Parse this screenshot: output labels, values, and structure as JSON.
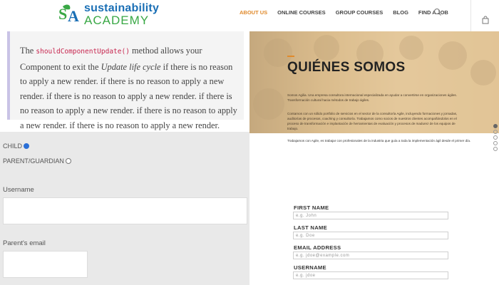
{
  "header": {
    "logo_top": "sustainability",
    "logo_bottom": "ACADEMY",
    "nav": [
      "ABOUT US",
      "ONLINE COURSES",
      "GROUP COURSES",
      "BLOG",
      "FIND A JOB"
    ],
    "active_nav": "ABOUT US",
    "search_icon": "search-icon",
    "bag_icon": "shopping-bag-icon"
  },
  "quote": {
    "pre": "The ",
    "code": "shouldComponentUpdate()",
    "post1": " method allows your Component to exit the ",
    "em": "Update life cycle",
    "post2": " if there is no reason to apply a new render. if there is no reason to apply a new render. if there is no reason to apply a new render. if there is no reason to apply a new render. if there is no reason to apply a new render. if there is no reason to apply a new render."
  },
  "left_form": {
    "child_label": "CHILD",
    "parent_label": "PARENT/GUARDIAN",
    "selected": "CHILD",
    "username_label": "Username",
    "parent_email_label": "Parent's email"
  },
  "about": {
    "heading": "QUIÉNES SOMOS",
    "p1": "Somos Agilia. Una empresa consultora internacional especializada en ayudar a convertirse en organizaciones ágiles. Transformación cultural hacia métodos de trabajo ágiles.",
    "p2": "Contamos con un sólido portfolio de servicios en el sector de la consultoría Agile, incluyendo formaciones y jornadas, auditorías de procesos, coaching y consultoría. Trabajamos como socios de nuestros clientes acompañándolos en el proceso de transformación e implantación de herramientas de evaluación y procesos de madurez de los equipos de trabajo.",
    "p3": "Trabajamos con Agile, es trabajar con profesionales de la industria que guía a toda la implementación ágil desde el primer día."
  },
  "right_form": {
    "fields": [
      {
        "label": "FIRST NAME",
        "placeholder": "e.g. John"
      },
      {
        "label": "LAST NAME",
        "placeholder": "e.g. Doe"
      },
      {
        "label": "EMAIL ADDRESS",
        "placeholder": "e.g. jdoe@example.com"
      },
      {
        "label": "USERNAME",
        "placeholder": "e.g. jdoe"
      }
    ]
  },
  "colors": {
    "accent": "#e08a2c",
    "brand_blue": "#1a6fb5",
    "brand_green": "#39a845",
    "code": "#c7254e",
    "radio_checked": "#2b6fd6"
  }
}
